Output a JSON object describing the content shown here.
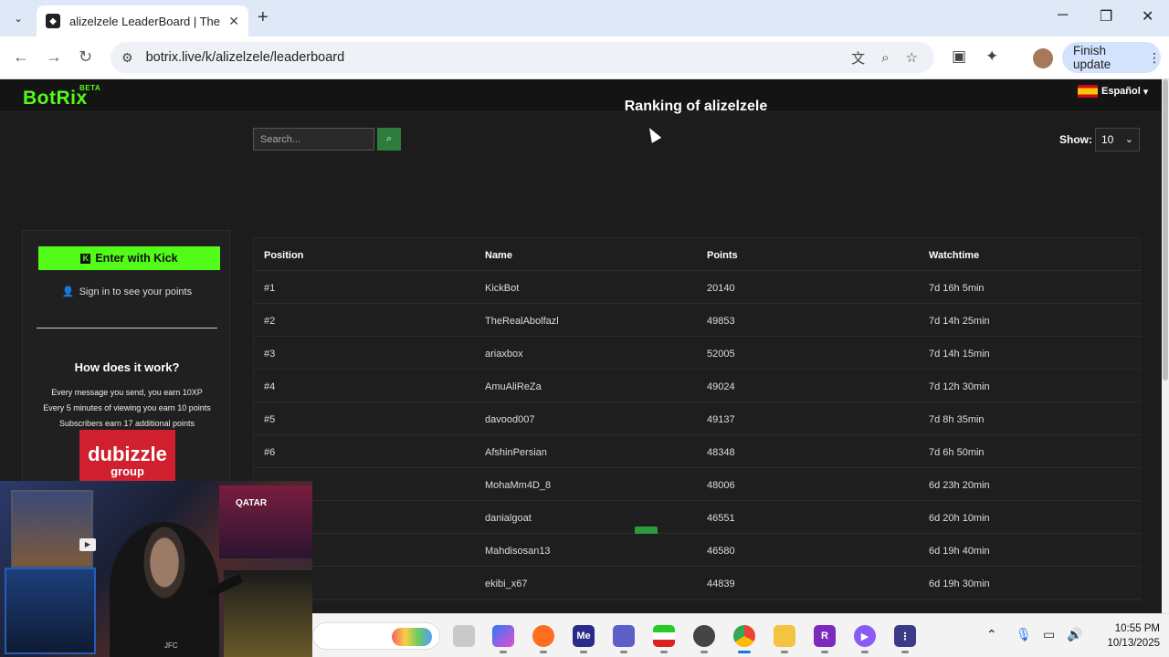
{
  "browser": {
    "tab_title": "alizelzele LeaderBoard | The be",
    "tab_close": "✕",
    "new_tab": "+",
    "url": "botrix.live/k/alizelzele/leaderboard",
    "finish_update": "Finish update",
    "finish_dots": "⋮"
  },
  "site": {
    "logo": "BotRix",
    "logo_badge": "BETA",
    "language": "Español",
    "language_chevron": "▾"
  },
  "main": {
    "title": "Ranking of alizelzele",
    "search_placeholder": "Search...",
    "show_label": "Show:",
    "show_value": "10"
  },
  "sidebar": {
    "kick_button": "Enter with Kick",
    "kick_letter": "K",
    "signin_text": "Sign in to see your points",
    "how_title": "How does it work?",
    "rule1": "Every message you send, you earn 10XP",
    "rule2": "Every 5 minutes of viewing you earn 10 points",
    "rule3": "Subscribers earn 17 additional points",
    "ad_brand": "dubizzle",
    "ad_sub": "group"
  },
  "table": {
    "headers": {
      "position": "Position",
      "name": "Name",
      "points": "Points",
      "watchtime": "Watchtime"
    },
    "rows": [
      {
        "position": "#1",
        "name": "KickBot",
        "points": "20140",
        "watchtime": "7d 16h 5min"
      },
      {
        "position": "#2",
        "name": "TheRealAbolfazl",
        "points": "49853",
        "watchtime": "7d 14h 25min"
      },
      {
        "position": "#3",
        "name": "ariaxbox",
        "points": "52005",
        "watchtime": "7d 14h 15min"
      },
      {
        "position": "#4",
        "name": "AmuAliReZa",
        "points": "49024",
        "watchtime": "7d 12h 30min"
      },
      {
        "position": "#5",
        "name": "davood007",
        "points": "49137",
        "watchtime": "7d 8h 35min"
      },
      {
        "position": "#6",
        "name": "AfshinPersian",
        "points": "48348",
        "watchtime": "7d 6h 50min"
      },
      {
        "position": "",
        "name": "MohaMm4D_8",
        "points": "48006",
        "watchtime": "6d 23h 20min"
      },
      {
        "position": "",
        "name": "danialgoat",
        "points": "46551",
        "watchtime": "6d 20h 10min"
      },
      {
        "position": "",
        "name": "Mahdisosan13",
        "points": "46580",
        "watchtime": "6d 19h 40min"
      },
      {
        "position": "",
        "name": "ekibi_x67",
        "points": "44839",
        "watchtime": "6d 19h 30min"
      }
    ]
  },
  "webcam": {
    "sign": "QATAR",
    "watermark": "JFC"
  },
  "taskbar": {
    "time": "10:55 PM",
    "date": "10/13/2025"
  },
  "colors": {
    "brand_green": "#53fc18",
    "background": "#1c1c1c"
  }
}
